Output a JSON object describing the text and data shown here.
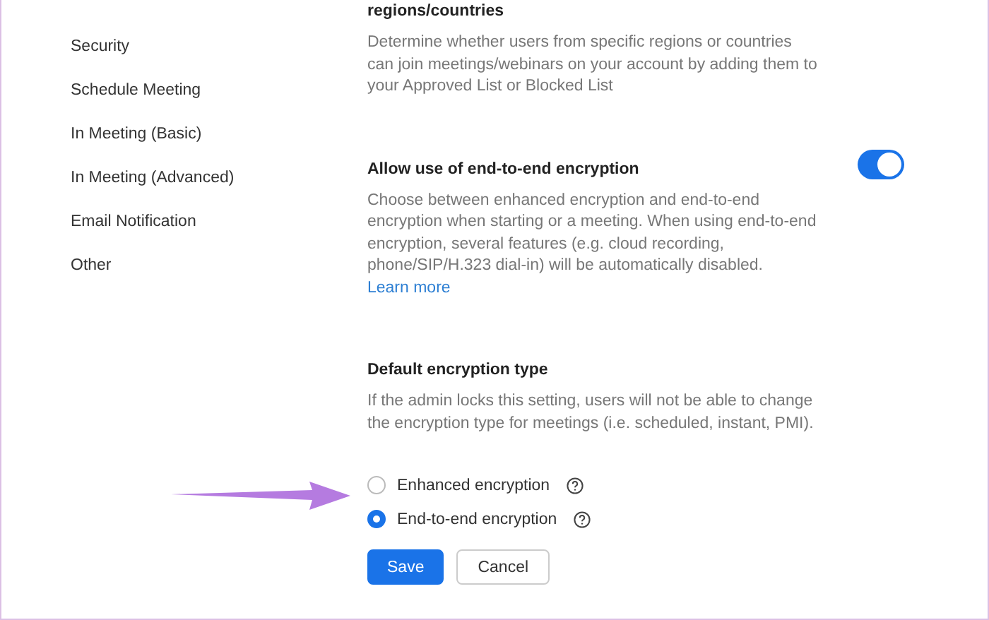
{
  "sidebar": {
    "items": [
      {
        "label": "Security"
      },
      {
        "label": "Schedule Meeting"
      },
      {
        "label": "In Meeting (Basic)"
      },
      {
        "label": "In Meeting (Advanced)"
      },
      {
        "label": "Email Notification"
      },
      {
        "label": "Other"
      }
    ]
  },
  "settings": [
    {
      "title": "regions/countries",
      "description": "Determine whether users from specific regions or countries can join meetings/webinars on your account by adding them to your Approved List or Blocked List"
    },
    {
      "title": "Allow use of end-to-end encryption",
      "description": "Choose between enhanced encryption and end-to-end encryption when starting or a meeting. When using end-to-end encryption, several features (e.g. cloud recording, phone/SIP/H.323 dial-in) will be automatically disabled.",
      "link": "Learn more",
      "toggle": {
        "on": true
      }
    }
  ],
  "default_encryption": {
    "title": "Default encryption type",
    "description": "If the admin locks this setting, users will not be able to change the encryption type for meetings (i.e. scheduled, instant, PMI).",
    "options": [
      {
        "label": "Enhanced encryption",
        "selected": false
      },
      {
        "label": "End-to-end encryption",
        "selected": true
      }
    ],
    "buttons": [
      {
        "label": "Save",
        "kind": "primary"
      },
      {
        "label": "Cancel",
        "kind": "secondary"
      }
    ]
  }
}
